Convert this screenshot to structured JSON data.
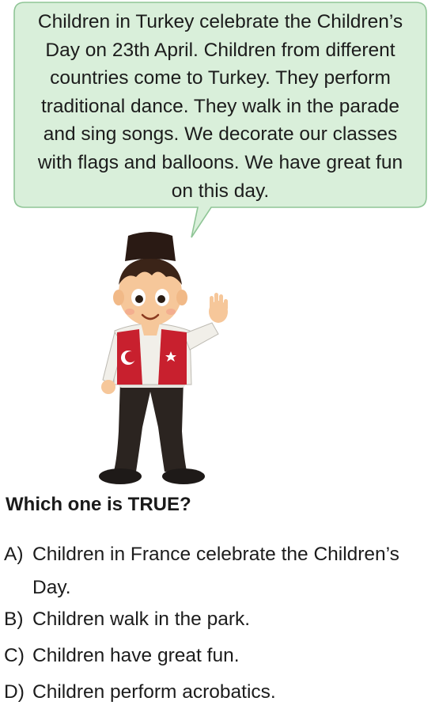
{
  "passage": {
    "lines": [
      "Children in Turkey celebrate the Children’s",
      "Day on 23th April. Children from different",
      "countries come to Turkey. They perform",
      "traditional dance. They walk in the parade",
      "and sing songs. We decorate our classes",
      "with flags and balloons. We have great fun",
      "on this day."
    ]
  },
  "question": {
    "text": "Which one is TRUE?"
  },
  "options": [
    {
      "letter": "A)",
      "text": "Children in France celebrate the Children’s",
      "continuation": "Day."
    },
    {
      "letter": "B)",
      "text": "Children walk in the park."
    },
    {
      "letter": "C)",
      "text": "Children have great fun."
    },
    {
      "letter": "D)",
      "text": "Children perform acrobatics."
    }
  ],
  "illustration": {
    "subject": "boy-in-turkish-costume",
    "vest_color": "#c8202e",
    "hat_color": "#2a1a14",
    "bubble_fill": "#d9efda",
    "bubble_stroke": "#8fc596"
  }
}
